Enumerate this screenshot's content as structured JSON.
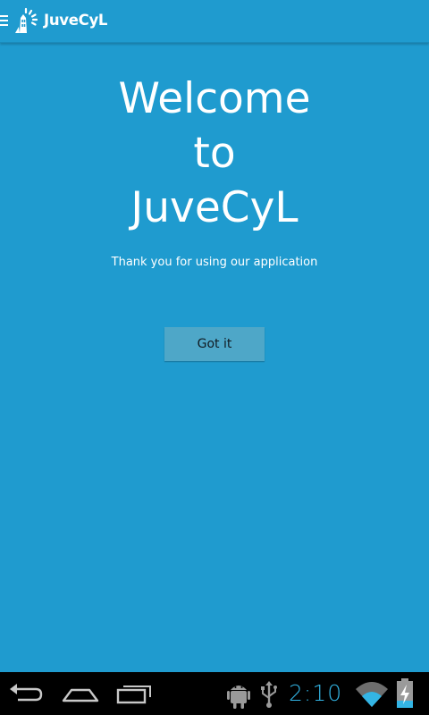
{
  "action_bar": {
    "app_title": "JuveCyL",
    "menu_icon": "hamburger-menu-icon",
    "logo_icon": "juvecyl-logo-icon"
  },
  "main": {
    "welcome_line1": "Welcome",
    "welcome_line2": "to",
    "welcome_line3": "JuveCyL",
    "thanks_text": "Thank you for using our application",
    "got_it_label": "Got it"
  },
  "system_bar": {
    "time": "2:10",
    "nav_icons": [
      "back-icon",
      "home-icon",
      "recent-apps-icon"
    ],
    "status_icons": [
      "android-debug-icon",
      "usb-icon",
      "wifi-icon",
      "battery-charging-icon"
    ]
  },
  "colors": {
    "background": "#1f9bcf",
    "button": "#4ea7c8",
    "clock": "#33b5e5",
    "system_bar": "#000000"
  }
}
